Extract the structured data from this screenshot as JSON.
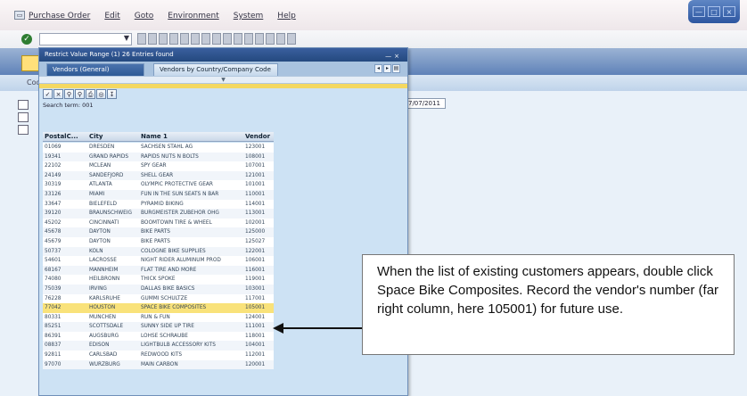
{
  "menu": [
    "Purchase Order",
    "Edit",
    "Goto",
    "Environment",
    "System",
    "Help"
  ],
  "app": {
    "coo_label": "Coo",
    "date_value": "7/07/2011"
  },
  "popup": {
    "title": "Restrict Value Range (1)   26 Entries found",
    "tabs": [
      "Vendors (General)",
      "Vendors by Country/Company Code"
    ],
    "search_hits": "Search term: 001",
    "columns": [
      "PostalC...",
      "City",
      "Name 1",
      "Vendor"
    ],
    "rows": [
      {
        "postal": "01069",
        "city": "DRESDEN",
        "name": "SACHSEN STAHL AG",
        "vendor": "123001"
      },
      {
        "postal": "19341",
        "city": "GRAND RAPIDS",
        "name": "RAPIDS NUTS N BOLTS",
        "vendor": "108001"
      },
      {
        "postal": "22102",
        "city": "MCLEAN",
        "name": "SPY GEAR",
        "vendor": "107001"
      },
      {
        "postal": "24149",
        "city": "SANDEFJORD",
        "name": "SHELL GEAR",
        "vendor": "121001"
      },
      {
        "postal": "30319",
        "city": "ATLANTA",
        "name": "OLYMPIC PROTECTIVE GEAR",
        "vendor": "101001"
      },
      {
        "postal": "33126",
        "city": "MIAMI",
        "name": "FUN IN THE SUN SEATS N BAR",
        "vendor": "110001"
      },
      {
        "postal": "33647",
        "city": "BIELEFELD",
        "name": "PYRAMID BIKING",
        "vendor": "114001"
      },
      {
        "postal": "39120",
        "city": "BRAUNSCHWEIG",
        "name": "BURGMEISTER ZUBEHOR OHG",
        "vendor": "113001"
      },
      {
        "postal": "45202",
        "city": "CINCINNATI",
        "name": "BOOMTOWN TIRE & WHEEL",
        "vendor": "102001"
      },
      {
        "postal": "45678",
        "city": "DAYTON",
        "name": "BIKE PARTS",
        "vendor": "125000"
      },
      {
        "postal": "45679",
        "city": "DAYTON",
        "name": "BIKE PARTS",
        "vendor": "125027"
      },
      {
        "postal": "50737",
        "city": "KOLN",
        "name": "COLOGNE BIKE SUPPLIES",
        "vendor": "122001"
      },
      {
        "postal": "54601",
        "city": "LACROSSE",
        "name": "NIGHT RIDER ALUMINUM PROD",
        "vendor": "106001"
      },
      {
        "postal": "68167",
        "city": "MANNHEIM",
        "name": "FLAT TIRE AND MORE",
        "vendor": "116001"
      },
      {
        "postal": "74080",
        "city": "HEILBRONN",
        "name": "THICK SPOKE",
        "vendor": "119001"
      },
      {
        "postal": "75039",
        "city": "IRVING",
        "name": "DALLAS BIKE BASICS",
        "vendor": "103001"
      },
      {
        "postal": "76228",
        "city": "KARLSRUHE",
        "name": "GUMMI SCHULTZE",
        "vendor": "117001"
      },
      {
        "postal": "77042",
        "city": "HOUSTON",
        "name": "SPACE BIKE COMPOSITES",
        "vendor": "105001",
        "highlight": true
      },
      {
        "postal": "80331",
        "city": "MUNCHEN",
        "name": "RUN & FUN",
        "vendor": "124001"
      },
      {
        "postal": "85251",
        "city": "SCOTTSDALE",
        "name": "SUNNY SIDE UP TIRE",
        "vendor": "111001"
      },
      {
        "postal": "86391",
        "city": "AUGSBURG",
        "name": "LOHSE SCHRAUBE",
        "vendor": "118001"
      },
      {
        "postal": "08837",
        "city": "EDISON",
        "name": "LIGHTBULB ACCESSORY KITS",
        "vendor": "104001"
      },
      {
        "postal": "92811",
        "city": "CARLSBAD",
        "name": "REDWOOD KITS",
        "vendor": "112001"
      },
      {
        "postal": "97070",
        "city": "WURZBURG",
        "name": "MAIN CARBON",
        "vendor": "120001"
      }
    ]
  },
  "callout": {
    "text": "When the list of existing customers appears, double click Space Bike Composites. Record the vendor's number (far right column, here 105001) for future use."
  },
  "colors": {
    "highlight": "#f9e27a",
    "title_bar": "#24497f",
    "popup_bg": "#cde2f4"
  },
  "icons": [
    "sap-icon",
    "ok-icon",
    "checkmark-icon",
    "close-icon",
    "save-icon",
    "print-icon",
    "arrow-icon"
  ]
}
